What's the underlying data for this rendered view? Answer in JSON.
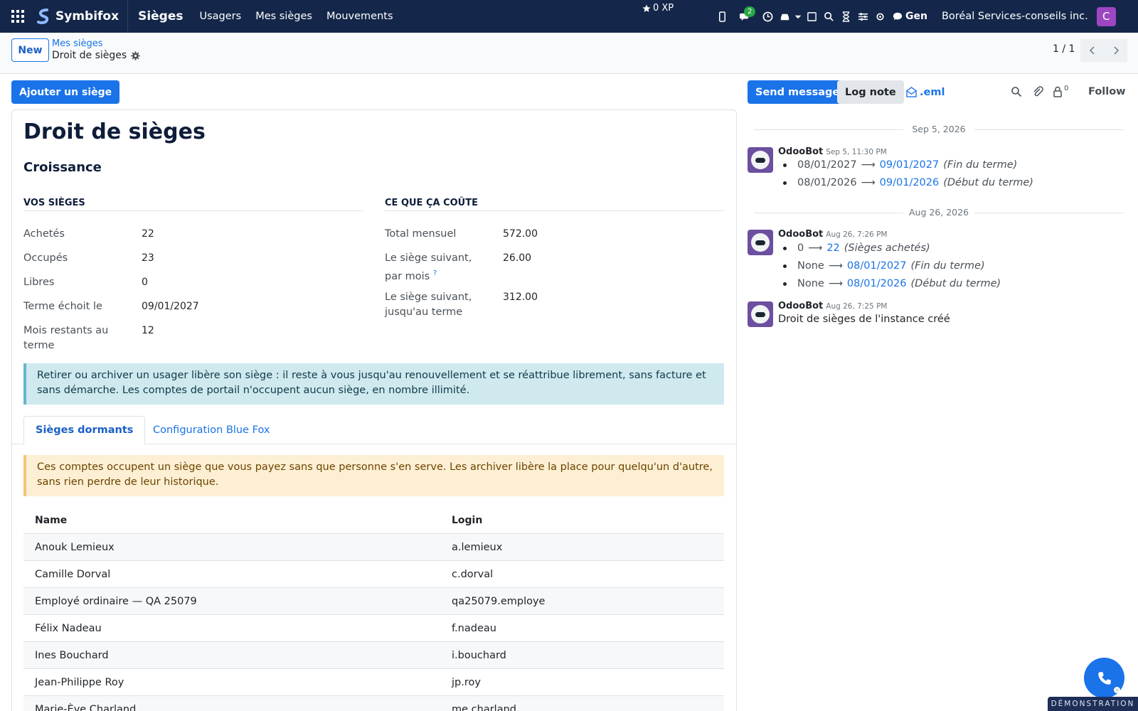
{
  "navbar": {
    "brand": "Symbifox",
    "app_name": "Sièges",
    "menu": [
      "Usagers",
      "Mes sièges",
      "Mouvements"
    ],
    "xp": "0 XP",
    "chat_badge": "2",
    "gen": "Gen",
    "company": "Boréal Services-conseils inc.",
    "avatar_initial": "C",
    "colors": {
      "bar": "#14274a",
      "avatar": "#9d46c2",
      "badge": "#28a745"
    }
  },
  "control_panel": {
    "new_label": "New",
    "breadcrumb_parent": "Mes sièges",
    "breadcrumb_current": "Droit de sièges",
    "pager": "1 / 1"
  },
  "form": {
    "add_seat_label": "Ajouter un siège",
    "title": "Droit de sièges",
    "subtitle": "Croissance",
    "left_group": {
      "heading": "VOS SIÈGES",
      "fields": [
        {
          "label": "Achetés",
          "value": "22"
        },
        {
          "label": "Occupés",
          "value": "23"
        },
        {
          "label": "Libres",
          "value": "0"
        },
        {
          "label": "Terme échoit le",
          "value": "09/01/2027"
        },
        {
          "label": "Mois restants au terme",
          "value": "12"
        }
      ]
    },
    "right_group": {
      "heading": "CE QUE ÇA COÛTE",
      "fields": [
        {
          "label": "Total mensuel",
          "value": "572.00"
        },
        {
          "label": "Le siège suivant, par mois",
          "help": "?",
          "value": "26.00"
        },
        {
          "label": "Le siège suivant, jusqu'au terme",
          "value": "312.00"
        }
      ]
    },
    "info_alert": "Retirer ou archiver un usager libère son siège : il reste à vous jusqu'au renouvellement et se réattribue librement, sans facture et sans démarche. Les comptes de portail n'occupent aucun siège, en nombre illimité.",
    "tabs": [
      "Sièges dormants",
      "Configuration Blue Fox"
    ],
    "warning_alert": "Ces comptes occupent un siège que vous payez sans que personne s'en serve. Les archiver libère la place pour quelqu'un d'autre, sans rien perdre de leur historique.",
    "table": {
      "columns": [
        "Name",
        "Login"
      ],
      "rows": [
        [
          "Anouk Lemieux",
          "a.lemieux"
        ],
        [
          "Camille Dorval",
          "c.dorval"
        ],
        [
          "Employé ordinaire — QA 25079",
          "qa25079.employe"
        ],
        [
          "Félix Nadeau",
          "f.nadeau"
        ],
        [
          "Ines Bouchard",
          "i.bouchard"
        ],
        [
          "Jean-Philippe Roy",
          "jp.roy"
        ],
        [
          "Marie-Ève Charland",
          "me.charland"
        ]
      ]
    }
  },
  "chatter": {
    "send_message": "Send message",
    "log_note": "Log note",
    "eml": ".eml",
    "follower_count": "0",
    "follow": "Follow",
    "groups": [
      {
        "date": "Sep 5, 2026",
        "messages": [
          {
            "author": "OdooBot",
            "time": "Sep 5, 11:30 PM",
            "tracking": [
              {
                "old": "08/01/2027",
                "new": "09/01/2027",
                "field": "(Fin du terme)"
              },
              {
                "old": "08/01/2026",
                "new": "09/01/2026",
                "field": "(Début du terme)"
              }
            ]
          }
        ]
      },
      {
        "date": "Aug 26, 2026",
        "messages": [
          {
            "author": "OdooBot",
            "time": "Aug 26, 7:26 PM",
            "tracking": [
              {
                "old": "0",
                "new": "22",
                "field": "(Sièges achetés)"
              },
              {
                "old": "None",
                "new": "08/01/2027",
                "field": "(Fin du terme)"
              },
              {
                "old": "None",
                "new": "08/01/2026",
                "field": "(Début du terme)"
              }
            ]
          },
          {
            "author": "OdooBot",
            "time": "Aug 26, 7:25 PM",
            "body": "Droit de sièges de l'instance créé"
          }
        ]
      }
    ]
  },
  "demo_label": "DÉMONSTRATION"
}
